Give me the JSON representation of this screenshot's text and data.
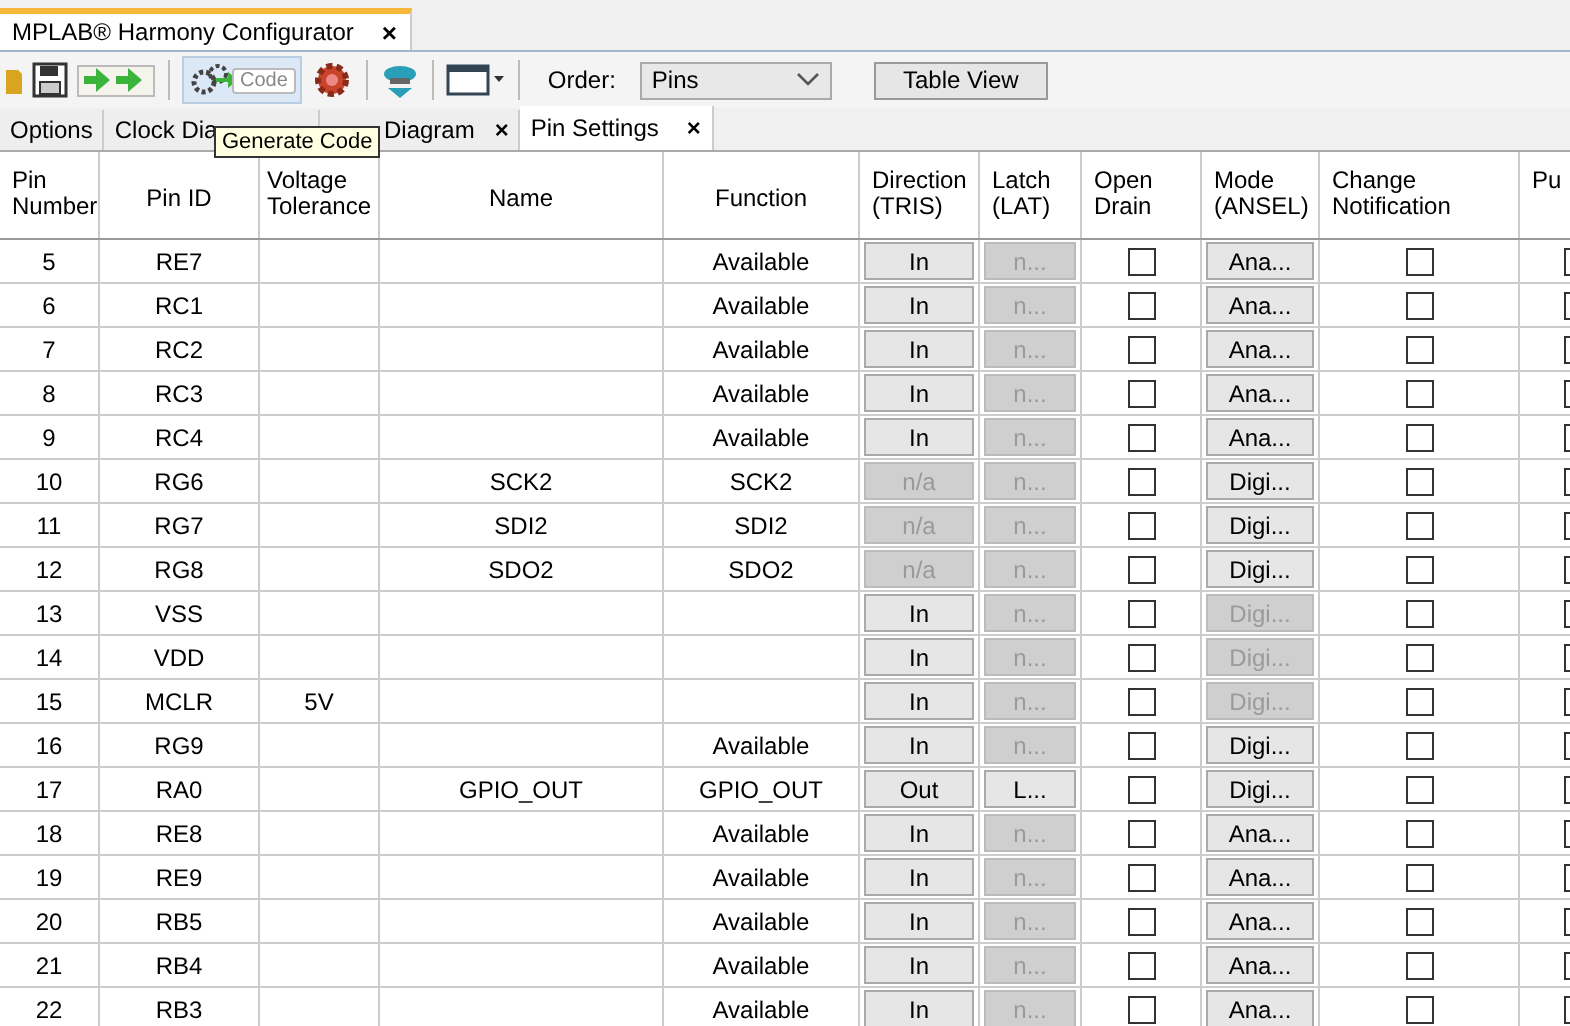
{
  "window": {
    "title": "MPLAB® Harmony Configurator",
    "close": "×"
  },
  "toolbar": {
    "code_button": "Code",
    "order_label": "Order:",
    "order_value": "Pins",
    "view_button": "Table View"
  },
  "tooltip": "Generate Code",
  "tabs": [
    {
      "label": "Options",
      "selected": false
    },
    {
      "label": "Clock Dia",
      "selected": false
    },
    {
      "label": "Diagram",
      "selected": false,
      "close": "×"
    },
    {
      "label": "Pin Settings",
      "selected": true,
      "close": "×"
    }
  ],
  "table": {
    "columns": [
      "Pin Number",
      "Pin ID",
      "Voltage Tolerance",
      "Name",
      "Function",
      "Direction (TRIS)",
      "Latch (LAT)",
      "Open Drain",
      "Mode (ANSEL)",
      "Change Notification",
      "Pu"
    ],
    "rows": [
      {
        "pin": "5",
        "id": "RE7",
        "function": "Available",
        "dir": {
          "text": "In",
          "disabled": false
        },
        "latch": {
          "text": "n...",
          "disabled": true
        },
        "odc": false,
        "mode": {
          "text": "Ana...",
          "disabled": false
        },
        "cn": false,
        "column_11": false
      },
      {
        "pin": "6",
        "id": "RC1",
        "function": "Available",
        "dir": {
          "text": "In",
          "disabled": false
        },
        "latch": {
          "text": "n...",
          "disabled": true
        },
        "odc": false,
        "mode": {
          "text": "Ana...",
          "disabled": false
        },
        "cn": false,
        "column_11": false
      },
      {
        "pin": "7",
        "id": "RC2",
        "function": "Available",
        "dir": {
          "text": "In",
          "disabled": false
        },
        "latch": {
          "text": "n...",
          "disabled": true
        },
        "odc": false,
        "mode": {
          "text": "Ana...",
          "disabled": false
        },
        "cn": false,
        "column_11": false
      },
      {
        "pin": "8",
        "id": "RC3",
        "function": "Available",
        "dir": {
          "text": "In",
          "disabled": false
        },
        "latch": {
          "text": "n...",
          "disabled": true
        },
        "odc": false,
        "mode": {
          "text": "Ana...",
          "disabled": false
        },
        "cn": false,
        "column_11": false
      },
      {
        "pin": "9",
        "id": "RC4",
        "function": "Available",
        "dir": {
          "text": "In",
          "disabled": false
        },
        "latch": {
          "text": "n...",
          "disabled": true
        },
        "odc": false,
        "mode": {
          "text": "Ana...",
          "disabled": false
        },
        "cn": false,
        "column_11": false
      },
      {
        "pin": "10",
        "id": "RG6",
        "name": "SCK2",
        "function": "SCK2",
        "dir": {
          "text": "n/a",
          "disabled": true
        },
        "latch": {
          "text": "n...",
          "disabled": true
        },
        "odc": false,
        "mode": {
          "text": "Digi...",
          "disabled": false
        },
        "cn": false,
        "column_11": false
      },
      {
        "pin": "11",
        "id": "RG7",
        "name": "SDI2",
        "function": "SDI2",
        "dir": {
          "text": "n/a",
          "disabled": true
        },
        "latch": {
          "text": "n...",
          "disabled": true
        },
        "odc": false,
        "mode": {
          "text": "Digi...",
          "disabled": false
        },
        "cn": false,
        "column_11": false
      },
      {
        "pin": "12",
        "id": "RG8",
        "name": "SDO2",
        "function": "SDO2",
        "dir": {
          "text": "n/a",
          "disabled": true
        },
        "latch": {
          "text": "n...",
          "disabled": true
        },
        "odc": false,
        "mode": {
          "text": "Digi...",
          "disabled": false
        },
        "cn": false,
        "column_11": false
      },
      {
        "pin": "13",
        "id": "VSS",
        "dir": {
          "text": "In",
          "disabled": false
        },
        "latch": {
          "text": "n...",
          "disabled": true
        },
        "odc": false,
        "mode": {
          "text": "Digi...",
          "disabled": true
        },
        "cn": false,
        "column_11": false
      },
      {
        "pin": "14",
        "id": "VDD",
        "dir": {
          "text": "In",
          "disabled": false
        },
        "latch": {
          "text": "n...",
          "disabled": true
        },
        "odc": false,
        "mode": {
          "text": "Digi...",
          "disabled": true
        },
        "cn": false,
        "column_11": false
      },
      {
        "pin": "15",
        "id": "MCLR",
        "volt": "5V",
        "dir": {
          "text": "In",
          "disabled": false
        },
        "latch": {
          "text": "n...",
          "disabled": true
        },
        "odc": false,
        "mode": {
          "text": "Digi...",
          "disabled": true
        },
        "cn": false,
        "column_11": false
      },
      {
        "pin": "16",
        "id": "RG9",
        "function": "Available",
        "dir": {
          "text": "In",
          "disabled": false
        },
        "latch": {
          "text": "n...",
          "disabled": true
        },
        "odc": false,
        "mode": {
          "text": "Digi...",
          "disabled": false
        },
        "cn": false,
        "column_11": false
      },
      {
        "pin": "17",
        "id": "RA0",
        "name": "GPIO_OUT",
        "function": "GPIO_OUT",
        "dir": {
          "text": "Out",
          "disabled": false
        },
        "latch": {
          "text": "L...",
          "disabled": false
        },
        "odc": false,
        "mode": {
          "text": "Digi...",
          "disabled": false
        },
        "cn": false,
        "column_11": false
      },
      {
        "pin": "18",
        "id": "RE8",
        "function": "Available",
        "dir": {
          "text": "In",
          "disabled": false
        },
        "latch": {
          "text": "n...",
          "disabled": true
        },
        "odc": false,
        "mode": {
          "text": "Ana...",
          "disabled": false
        },
        "cn": false,
        "column_11": false
      },
      {
        "pin": "19",
        "id": "RE9",
        "function": "Available",
        "dir": {
          "text": "In",
          "disabled": false
        },
        "latch": {
          "text": "n...",
          "disabled": true
        },
        "odc": false,
        "mode": {
          "text": "Ana...",
          "disabled": false
        },
        "cn": false,
        "column_11": false
      },
      {
        "pin": "20",
        "id": "RB5",
        "function": "Available",
        "dir": {
          "text": "In",
          "disabled": false
        },
        "latch": {
          "text": "n...",
          "disabled": true
        },
        "odc": false,
        "mode": {
          "text": "Ana...",
          "disabled": false
        },
        "cn": false,
        "column_11": false
      },
      {
        "pin": "21",
        "id": "RB4",
        "function": "Available",
        "dir": {
          "text": "In",
          "disabled": false
        },
        "latch": {
          "text": "n...",
          "disabled": true
        },
        "odc": false,
        "mode": {
          "text": "Ana...",
          "disabled": false
        },
        "cn": false,
        "column_11": false
      },
      {
        "pin": "22",
        "id": "RB3",
        "function": "Available",
        "dir": {
          "text": "In",
          "disabled": false
        },
        "latch": {
          "text": "n...",
          "disabled": true
        },
        "odc": false,
        "mode": {
          "text": "Ana...",
          "disabled": false
        },
        "cn": false,
        "column_11": false
      }
    ]
  }
}
